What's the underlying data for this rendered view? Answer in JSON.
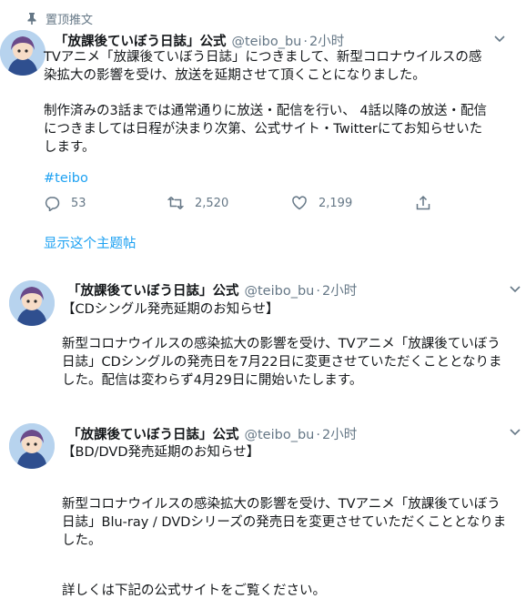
{
  "pinned": {
    "label": "置顶推文"
  },
  "tweets": [
    {
      "name": "「放課後ていぼう日誌」公式",
      "handle": "@teibo_bu",
      "dot": "·",
      "time": "2小时",
      "paragraph1": [
        "TVアニメ「放課後ていぼう日誌」につきまして、新型コロナウイルスの感",
        "染拡大の影響を受け、放送を延期させて頂くことになりました。"
      ],
      "paragraph2": [
        "制作済みの3話までは通常通りに放送・配信を行い、 4話以降の放送・配信",
        "につきましては日程が決まり次第、公式サイト・Twitterにてお知らせいた",
        "します。"
      ],
      "hashtag": "#teibo",
      "reply_count": "53",
      "retweet_count": "2,520",
      "like_count": "2,199",
      "show_thread": "显示这个主题帖"
    },
    {
      "name": "「放課後ていぼう日誌」公式",
      "handle": "@teibo_bu",
      "dot": "·",
      "time": "2小时",
      "heading": "【CDシングル発売延期のお知らせ】",
      "body": [
        "新型コロナウイルスの感染拡大の影響を受け、TVアニメ「放課後ていぼう",
        "日誌」CDシングルの発売日を7月22日に変更させていただくこととなりま",
        "した。配信は変わらず4月29日に開始いたします。"
      ]
    },
    {
      "name": "「放課後ていぼう日誌」公式",
      "handle": "@teibo_bu",
      "dot": "·",
      "time": "2小时",
      "heading": "【BD/DVD発売延期のお知らせ】",
      "body": [
        "新型コロナウイルスの感染拡大の影響を受け、TVアニメ「放課後ていぼう",
        "日誌」Blu-ray / DVDシリーズの発売日を変更させていただくこととなりま",
        "した。"
      ],
      "footer": "詳しくは下記の公式サイトをご覧ください。"
    }
  ],
  "colors": {
    "link": "#1da1f2",
    "muted": "#657786",
    "text": "#14171a"
  },
  "icons": [
    "pin-icon",
    "chevron-down-icon",
    "reply-icon",
    "retweet-icon",
    "like-icon",
    "share-icon"
  ]
}
